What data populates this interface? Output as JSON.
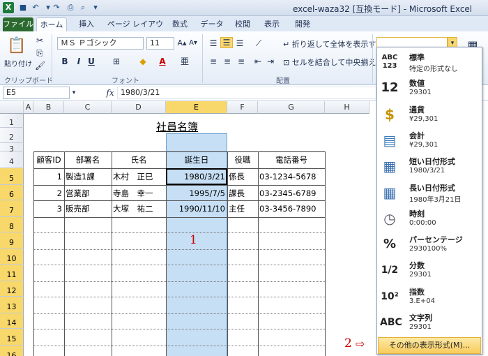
{
  "window": {
    "title": "excel-waza32 [互換モード] - Microsoft Excel"
  },
  "tabs": [
    "ファイル",
    "ホーム",
    "挿入",
    "ページ レイアウト",
    "数式",
    "データ",
    "校閲",
    "表示",
    "開発"
  ],
  "ribbon": {
    "paste_label": "貼り付け",
    "clipboard_label": "クリップボード",
    "font_name": "ＭＳ Ｐゴシック",
    "font_size": "11",
    "font_label": "フォント",
    "bold": "B",
    "italic": "I",
    "underline": "U",
    "wrap_text": "折り返して全体を表示する",
    "merge_center": "セルを結合して中央揃え",
    "alignment_label": "配置",
    "number_format_value": ""
  },
  "formula_bar": {
    "cell_ref": "E5",
    "fx": "fx",
    "value": "1980/3/21"
  },
  "sheet": {
    "columns": [
      "A",
      "B",
      "C",
      "D",
      "E",
      "F",
      "G",
      "H"
    ],
    "rows": [
      "1",
      "2",
      "3",
      "4",
      "5",
      "6",
      "7",
      "8",
      "9",
      "10",
      "11",
      "12",
      "13",
      "14",
      "15",
      "16"
    ],
    "title": "社員名簿",
    "headers": [
      "顧客ID",
      "部署名",
      "氏名",
      "誕生日",
      "役職",
      "電話番号"
    ],
    "data": [
      [
        "1",
        "製造1課",
        "木村　正巳",
        "1980/3/21",
        "係長",
        "03-1234-5678"
      ],
      [
        "2",
        "営業部",
        "寺島　幸一",
        "1995/7/5",
        "課長",
        "03-2345-6789"
      ],
      [
        "3",
        "販売部",
        "大塚　祐二",
        "1990/11/10",
        "主任",
        "03-3456-7890"
      ]
    ],
    "annotation_1": "1",
    "annotation_2": "2"
  },
  "number_format_menu": {
    "items": [
      {
        "icon": "ABC 123",
        "name": "標準",
        "sample": "特定の形式なし"
      },
      {
        "icon": "12",
        "name": "数値",
        "sample": "29301"
      },
      {
        "icon": "$",
        "name": "通貨",
        "sample": "¥29,301"
      },
      {
        "icon": "calc",
        "name": "会計",
        "sample": "¥29,301"
      },
      {
        "icon": "cal",
        "name": "短い日付形式",
        "sample": "1980/3/21"
      },
      {
        "icon": "cal",
        "name": "長い日付形式",
        "sample": "1980年3月21日"
      },
      {
        "icon": "clock",
        "name": "時刻",
        "sample": "0:00:00"
      },
      {
        "icon": "%",
        "name": "パーセンテージ",
        "sample": "2930100%"
      },
      {
        "icon": "1/2",
        "name": "分数",
        "sample": "29301"
      },
      {
        "icon": "10²",
        "name": "指数",
        "sample": "3.E+04"
      },
      {
        "icon": "ABC",
        "name": "文字列",
        "sample": "29301"
      }
    ],
    "more": "その他の表示形式(M)..."
  },
  "colors": {
    "selection": "#c6dff5",
    "accent": "#2a6a2f",
    "header_sel": "#f8d86a",
    "annotation": "#cc0000"
  }
}
